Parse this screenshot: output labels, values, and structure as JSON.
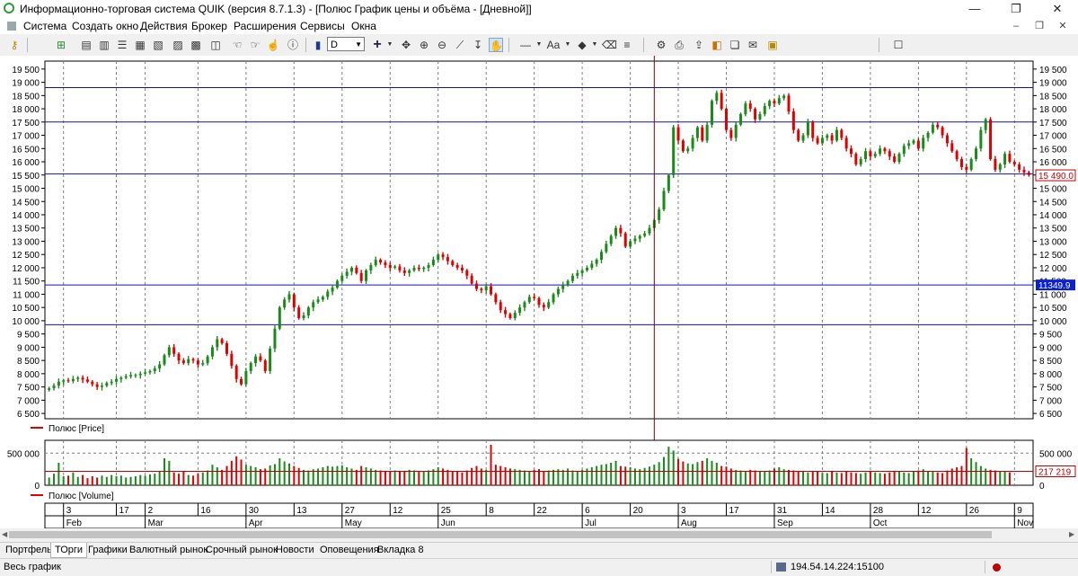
{
  "window": {
    "title": "Информационно-торговая система QUIK (версия 8.7.1.3) - [Полюс График цены и объёма - [Дневной]]",
    "minimize": "—",
    "restore": "❐",
    "close": "✕"
  },
  "menu": [
    "Система",
    "Создать окно",
    "Действия",
    "Брокер",
    "Расширения",
    "Сервисы",
    "Окна"
  ],
  "menu_buttons": {
    "minimize": "–",
    "restore": "❐",
    "close": "✕"
  },
  "toolbar": {
    "interval": "D",
    "icons": [
      "key-icon",
      "new-window-icon",
      "quotes-icon",
      "chart-icon",
      "table-icon",
      "orders-icon",
      "portfolio-icon",
      "deals-icon",
      "transaction-icon",
      "stop-order-icon",
      "hand-icon",
      "hand-icon",
      "hand-icon",
      "info-icon",
      "bar-chart-icon",
      "crosshair-icon",
      "move-icon",
      "zoom-in-icon",
      "zoom-out-icon",
      "ruler-icon",
      "pan-icon",
      "line-icon",
      "text-icon",
      "fill-icon",
      "eraser-icon",
      "layers-icon",
      "settings-icon",
      "print-icon",
      "export-icon",
      "template-icon",
      "copy-icon",
      "report-icon",
      "message-icon"
    ]
  },
  "chart_data": {
    "type": "candlestick",
    "price": {
      "legend": "Полюс [Price]",
      "ylim": [
        6300,
        19800
      ],
      "yticks": [
        6500,
        7000,
        7500,
        8000,
        8500,
        9000,
        9500,
        10000,
        10500,
        11000,
        11500,
        12000,
        12500,
        13000,
        13500,
        14000,
        14500,
        15000,
        15500,
        16000,
        16500,
        17000,
        17500,
        18000,
        18500,
        19000,
        19500
      ],
      "ytick_labels": [
        "6 500",
        "7 000",
        "7 500",
        "8 000",
        "8 500",
        "9 000",
        "9 500",
        "10 000",
        "10 500",
        "11 000",
        "11 500",
        "12 000",
        "12 500",
        "13 000",
        "13 500",
        "14 000",
        "14 500",
        "15 000",
        "15 500",
        "16 000",
        "16 500",
        "17 000",
        "17 500",
        "18 000",
        "18 500",
        "19 000",
        "19 500"
      ],
      "hlines": [
        18800,
        17500,
        15540,
        11349.9,
        9850
      ],
      "last_price_label": "15 490.0",
      "last_price": 15490,
      "hline_label": "11349.9",
      "hline_value": 11349.9,
      "cursor_index": 126,
      "close": [
        7450,
        7550,
        7700,
        7750,
        7720,
        7800,
        7850,
        7780,
        7700,
        7600,
        7500,
        7550,
        7650,
        7700,
        7800,
        7850,
        7900,
        7950,
        7950,
        8000,
        8050,
        8100,
        8200,
        8350,
        8700,
        9000,
        8750,
        8500,
        8400,
        8550,
        8500,
        8350,
        8400,
        8650,
        9000,
        9300,
        9150,
        8750,
        8300,
        7800,
        7600,
        8100,
        8400,
        8650,
        8500,
        8100,
        8950,
        9700,
        10500,
        10800,
        11000,
        10500,
        10100,
        10200,
        10500,
        10700,
        10800,
        10900,
        11100,
        11250,
        11500,
        11700,
        11850,
        12000,
        11800,
        11500,
        11900,
        12100,
        12300,
        12200,
        12100,
        12000,
        12050,
        11900,
        11800,
        11900,
        12000,
        11950,
        12000,
        12100,
        12300,
        12500,
        12400,
        12250,
        12100,
        12000,
        11900,
        11700,
        11400,
        11200,
        11150,
        11300,
        11000,
        10700,
        10400,
        10250,
        10100,
        10300,
        10500,
        10700,
        10900,
        10850,
        10600,
        10500,
        10700,
        11000,
        11200,
        11350,
        11500,
        11700,
        11800,
        11900,
        12000,
        12150,
        12300,
        12600,
        12900,
        13200,
        13500,
        13300,
        12800,
        13000,
        13100,
        13200,
        13300,
        13500,
        13800,
        14200,
        14900,
        15500,
        17300,
        16800,
        16400,
        16500,
        16900,
        17300,
        16800,
        17400,
        18300,
        18600,
        18000,
        17200,
        16900,
        17400,
        17800,
        18200,
        18000,
        17600,
        17800,
        18100,
        18300,
        18200,
        18400,
        18500,
        17900,
        17200,
        16800,
        17000,
        17500,
        16900,
        16700,
        16900,
        17000,
        16800,
        17200,
        16900,
        16500,
        16300,
        15900,
        16100,
        16400,
        16200,
        16300,
        16500,
        16400,
        16200,
        16000,
        16300,
        16600,
        16700,
        16800,
        16500,
        16900,
        17100,
        17400,
        17300,
        17000,
        16700,
        16400,
        16100,
        15800,
        15700,
        16100,
        16500,
        17200,
        17600,
        16100,
        15700,
        15900,
        16300,
        16000,
        15900,
        15700,
        15600,
        15500
      ]
    },
    "volume": {
      "legend": "Полюс [Volume]",
      "ylim": [
        0,
        700000
      ],
      "yticks": [
        0,
        500000
      ],
      "ytick_labels": [
        "0",
        "500 000"
      ],
      "reference_label": "217 219",
      "reference": 217219,
      "values": [
        120000,
        180000,
        350000,
        140000,
        150000,
        200000,
        130000,
        160000,
        110000,
        140000,
        120000,
        150000,
        130000,
        160000,
        140000,
        150000,
        120000,
        130000,
        140000,
        160000,
        150000,
        170000,
        180000,
        220000,
        420000,
        380000,
        200000,
        180000,
        210000,
        160000,
        150000,
        180000,
        200000,
        230000,
        320000,
        280000,
        240000,
        300000,
        380000,
        450000,
        400000,
        320000,
        300000,
        280000,
        250000,
        260000,
        310000,
        330000,
        420000,
        370000,
        340000,
        300000,
        270000,
        240000,
        230000,
        250000,
        260000,
        280000,
        300000,
        290000,
        300000,
        310000,
        280000,
        260000,
        240000,
        300000,
        280000,
        260000,
        240000,
        230000,
        220000,
        210000,
        230000,
        220000,
        210000,
        240000,
        230000,
        220000,
        210000,
        230000,
        250000,
        280000,
        260000,
        240000,
        220000,
        210000,
        200000,
        230000,
        270000,
        300000,
        260000,
        240000,
        630000,
        320000,
        300000,
        280000,
        260000,
        250000,
        240000,
        230000,
        220000,
        240000,
        250000,
        220000,
        230000,
        240000,
        250000,
        240000,
        260000,
        230000,
        220000,
        240000,
        260000,
        280000,
        300000,
        320000,
        330000,
        350000,
        380000,
        300000,
        290000,
        280000,
        260000,
        250000,
        270000,
        290000,
        320000,
        360000,
        440000,
        600000,
        540000,
        410000,
        370000,
        340000,
        330000,
        360000,
        380000,
        420000,
        380000,
        350000,
        300000,
        290000,
        260000,
        240000,
        230000,
        220000,
        240000,
        230000,
        220000,
        210000,
        230000,
        260000,
        280000,
        250000,
        240000,
        230000,
        220000,
        210000,
        200000,
        210000,
        220000,
        200000,
        190000,
        210000,
        200000,
        190000,
        210000,
        200000,
        190000,
        180000,
        200000,
        210000,
        200000,
        190000,
        180000,
        200000,
        210000,
        220000,
        200000,
        190000,
        210000,
        230000,
        250000,
        220000,
        210000,
        200000,
        190000,
        230000,
        260000,
        280000,
        300000,
        580000,
        420000,
        360000,
        300000,
        260000,
        240000,
        230000,
        220000,
        210000,
        200000
      ]
    },
    "x_axis": {
      "day_labels": [
        {
          "index": 3,
          "text": "3"
        },
        {
          "index": 14,
          "text": "17"
        },
        {
          "index": 20,
          "text": "2"
        },
        {
          "index": 31,
          "text": "16"
        },
        {
          "index": 41,
          "text": "30"
        },
        {
          "index": 51,
          "text": "13"
        },
        {
          "index": 61,
          "text": "27"
        },
        {
          "index": 71,
          "text": "12"
        },
        {
          "index": 81,
          "text": "25"
        },
        {
          "index": 91,
          "text": "8"
        },
        {
          "index": 101,
          "text": "22"
        },
        {
          "index": 111,
          "text": "6"
        },
        {
          "index": 121,
          "text": "20"
        },
        {
          "index": 131,
          "text": "3"
        },
        {
          "index": 141,
          "text": "17"
        },
        {
          "index": 151,
          "text": "31"
        },
        {
          "index": 161,
          "text": "14"
        },
        {
          "index": 171,
          "text": "28"
        },
        {
          "index": 181,
          "text": "12"
        },
        {
          "index": 191,
          "text": "26"
        },
        {
          "index": 201,
          "text": "9"
        }
      ],
      "month_labels": [
        {
          "index": 3,
          "text": "Feb"
        },
        {
          "index": 20,
          "text": "Mar"
        },
        {
          "index": 41,
          "text": "Apr"
        },
        {
          "index": 61,
          "text": "May"
        },
        {
          "index": 81,
          "text": "Jun"
        },
        {
          "index": 111,
          "text": "Jul"
        },
        {
          "index": 131,
          "text": "Aug"
        },
        {
          "index": 151,
          "text": "Sep"
        },
        {
          "index": 171,
          "text": "Oct"
        },
        {
          "index": 201,
          "text": "Nov"
        }
      ],
      "vgrid_index": [
        3,
        14,
        20,
        31,
        41,
        51,
        61,
        71,
        81,
        91,
        101,
        111,
        121,
        131,
        141,
        151,
        161,
        171,
        181,
        191,
        201
      ]
    },
    "colors": {
      "up": "#1a8a1a",
      "down": "#e00000",
      "hline": "#1010c0",
      "cursor": "#8a0000",
      "grid": "#808080"
    }
  },
  "tabs": [
    "Портфель",
    "ТОрги",
    "Графики",
    "Валютный рынок",
    "Срочный рынок",
    "Новости",
    "Оповещения",
    "Вкладка 8"
  ],
  "active_tab": 1,
  "status": {
    "left": "Весь график",
    "server": "194.54.14.224:15100"
  }
}
